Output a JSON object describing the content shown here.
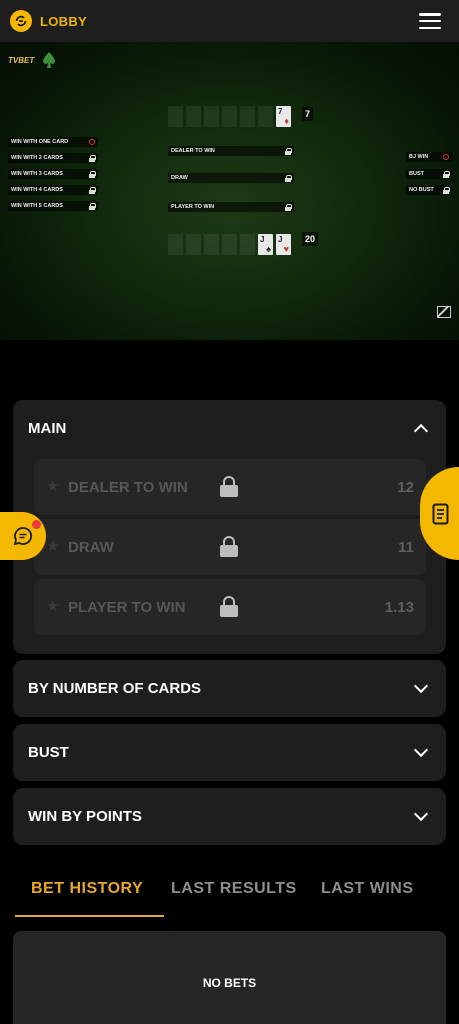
{
  "header": {
    "lobby_label": "LOBBY",
    "lobby_icon": "lobby-logo-icon",
    "menu_icon": "hamburger-menu-icon"
  },
  "video": {
    "brand": "TVBET",
    "dealer_score": "7",
    "player_score": "20",
    "dealer_cards": [
      {
        "rank": "7",
        "suit": "♦",
        "color": "#c0392b"
      }
    ],
    "player_cards": [
      {
        "rank": "J",
        "suit": "♠",
        "color": "#222222"
      },
      {
        "rank": "J",
        "suit": "♥",
        "color": "#c0392b"
      }
    ],
    "left_bets": [
      "WIN WITH ONE CARD",
      "WIN WITH 2 CARDS",
      "WIN WITH 3 CARDS",
      "WIN WITH 4 CARDS",
      "WIN WITH 5 CARDS"
    ],
    "center_bets": [
      "DEALER TO WIN",
      "DRAW",
      "PLAYER TO WIN"
    ],
    "right_bets": [
      "BJ WIN",
      "BUST",
      "NO BUST"
    ]
  },
  "main": {
    "title": "MAIN",
    "options": [
      {
        "name": "DEALER TO WIN",
        "odds": "12"
      },
      {
        "name": "DRAW",
        "odds": "11"
      },
      {
        "name": "PLAYER TO WIN",
        "odds": "1.13"
      }
    ]
  },
  "sections": {
    "by_number_of_cards": "BY NUMBER OF CARDS",
    "bust": "BUST",
    "win_by_points": "WIN BY POINTS"
  },
  "history": {
    "tabs": [
      "BET HISTORY",
      "LAST RESULTS",
      "LAST WINS"
    ],
    "active_tab": "BET HISTORY",
    "empty_text": "NO BETS"
  },
  "colors": {
    "accent": "#f5b800",
    "tab_active": "#e6a82c",
    "panel_bg": "#1e1e1e",
    "notification": "#e83a3a"
  }
}
